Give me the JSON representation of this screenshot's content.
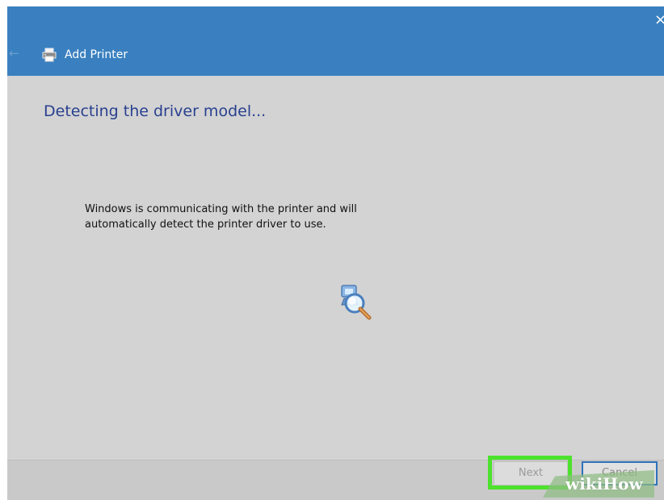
{
  "window": {
    "title": "Add Printer",
    "accent_color": "#3a80c0",
    "background_color": "#d3d3d3",
    "close_glyph": "×",
    "back_glyph": "←"
  },
  "content": {
    "heading": "Detecting the driver model...",
    "message_line1": "Windows is communicating with the printer and will",
    "message_line2": "automatically detect the printer driver to use."
  },
  "footer": {
    "next_label": "Next",
    "cancel_label": "Cancel",
    "highlight_color": "#4de22d"
  },
  "watermark": {
    "text": "wikiHow"
  },
  "icons": {
    "back": "back-arrow-icon",
    "printer": "printer-icon",
    "close": "close-icon",
    "search": "magnifier-search-icon"
  }
}
